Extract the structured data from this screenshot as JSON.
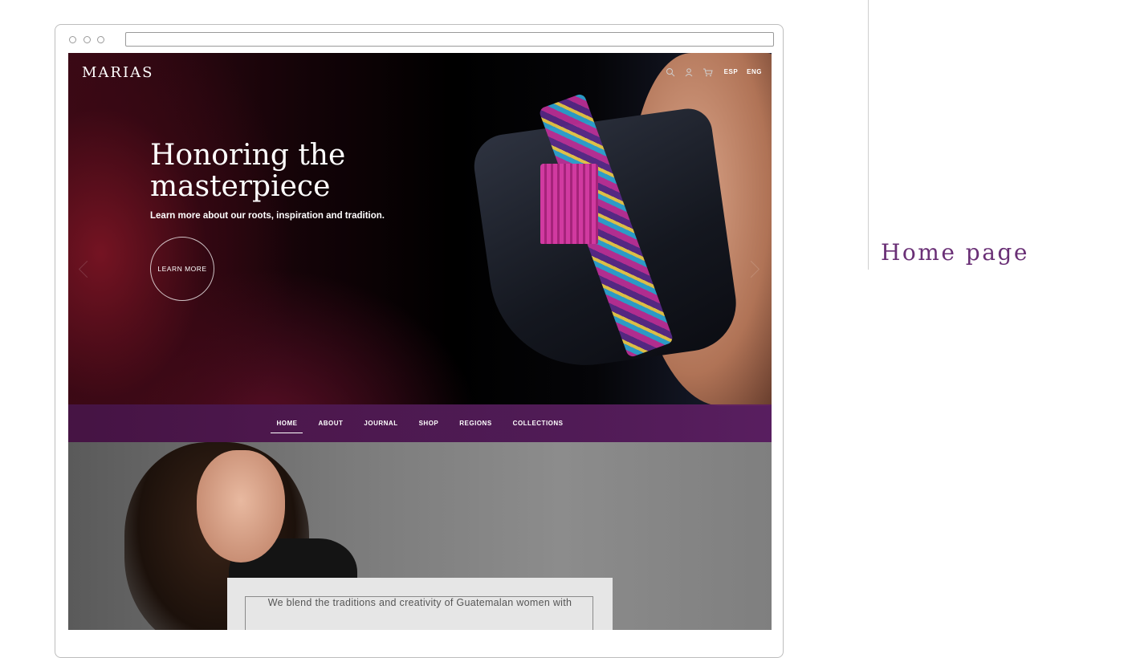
{
  "site": {
    "logo": "MARIAS",
    "header": {
      "lang_esp": "ESP",
      "lang_eng": "ENG"
    },
    "hero": {
      "title": "Honoring the masterpiece",
      "subtitle": "Learn more about our roots, inspiration and tradition.",
      "cta_label": "LEARN MORE"
    },
    "nav": {
      "items": [
        {
          "label": "HOME",
          "active": true
        },
        {
          "label": "ABOUT"
        },
        {
          "label": "JOURNAL"
        },
        {
          "label": "SHOP"
        },
        {
          "label": "REGIONS"
        },
        {
          "label": "COLLECTIONS"
        }
      ]
    },
    "about_card": {
      "text": "We blend the traditions and creativity of Guatemalan women with"
    }
  },
  "caption": "Home page",
  "colors": {
    "nav_bg": "#521c58",
    "caption": "#6a3076"
  },
  "icons": [
    "search-icon",
    "user-icon",
    "cart-icon"
  ]
}
